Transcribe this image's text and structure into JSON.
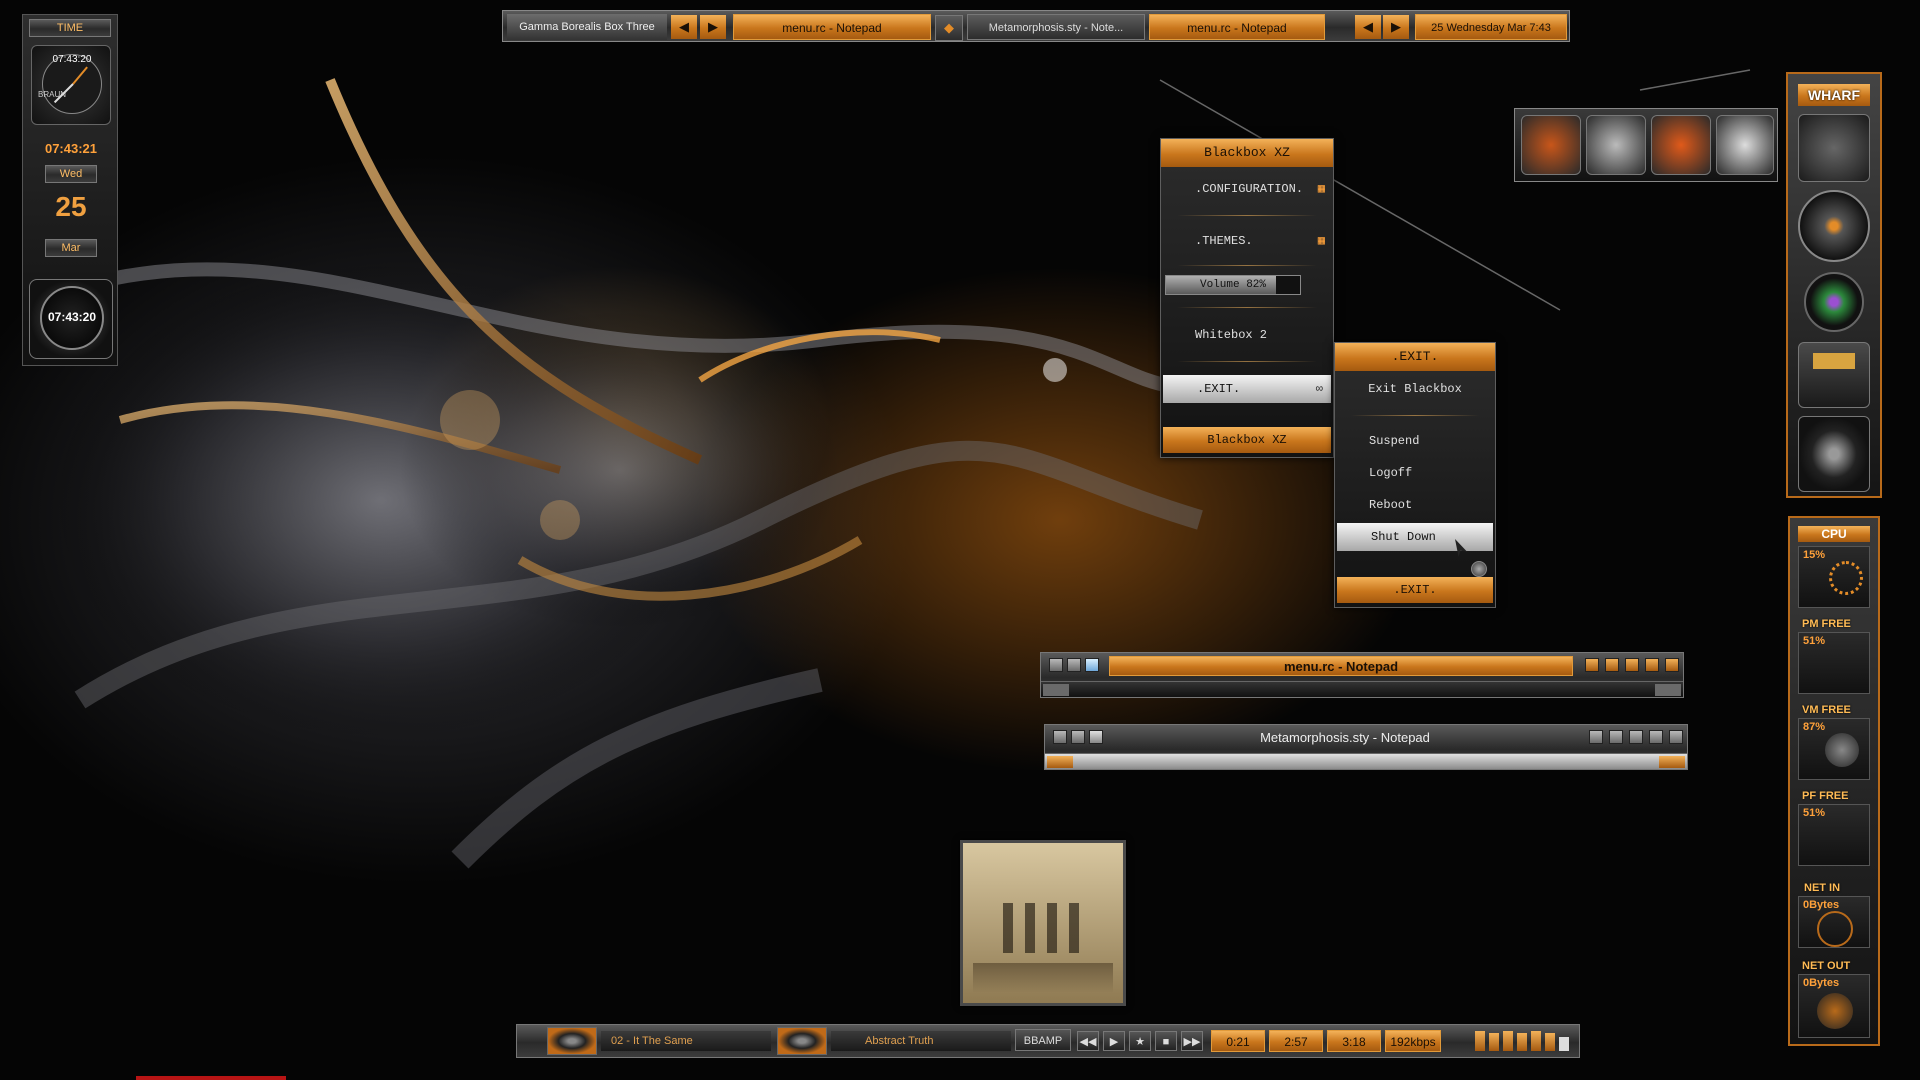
{
  "toolbar": {
    "workspace": "Gamma Borealis Box Three",
    "tasks": [
      "menu.rc - Notepad",
      "Metamorphosis.sty - Note...",
      "menu.rc - Notepad"
    ],
    "clock": "25 Wednesday Mar 7:43",
    "prev_glyph": "◀",
    "next_glyph": "▶",
    "task_glyph": "◆"
  },
  "time_widget": {
    "title": "TIME",
    "analog_time": "07:43:20",
    "brand": "BRAUN",
    "digital_time": "07:43:21",
    "weekday": "Wed",
    "day": "25",
    "month": "Mar",
    "dial_time": "07:43:20"
  },
  "root_menu": {
    "title": "Blackbox XZ",
    "items": [
      ".CONFIGURATION.",
      ".THEMES.",
      "Whitebox 2",
      ".EXIT."
    ],
    "volume": "Volume  82%",
    "volume_level": 0.82,
    "footer": "Blackbox XZ",
    "submenu_glyph": "▦"
  },
  "exit_menu": {
    "title": ".EXIT.",
    "items": [
      "Exit  Blackbox",
      "Suspend",
      "Logoff",
      "Reboot",
      "Shut Down"
    ],
    "footer": ".EXIT."
  },
  "windows": [
    {
      "title": "menu.rc - Notepad",
      "state": "active"
    },
    {
      "title": "Metamorphosis.sty - Notepad",
      "state": "inactive"
    }
  ],
  "slit": {
    "title": "WHARF",
    "icons": [
      "monitor-icon",
      "settings-icon",
      "refresh-icon",
      "music-icon"
    ]
  },
  "monitor": {
    "title": "CPU",
    "cpu": "15%",
    "pm_label": "PM FREE",
    "pm": "51%",
    "vm_label": "VM FREE",
    "vm": "87%",
    "pf_label": "PF FREE",
    "pf": "51%",
    "netin_label": "NET IN",
    "netin": "0Bytes",
    "netout_label": "NET OUT",
    "netout": "0Bytes"
  },
  "player": {
    "track": "02 - It The Same",
    "artist": "Abstract Truth",
    "app": "BBAMP",
    "elapsed": "0:21",
    "remaining": "2:57",
    "total": "3:18",
    "bitrate": "192kbps"
  },
  "colors": {
    "accent": "#e38c28",
    "accent_dark": "#a55a10",
    "panel": "#2a2a2a"
  }
}
